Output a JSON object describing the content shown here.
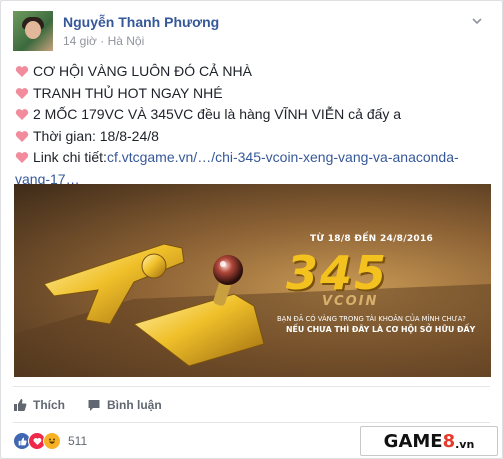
{
  "post": {
    "author": "Nguyễn Thanh Phương",
    "time": "14 giờ",
    "separator": "·",
    "location": "Hà Nội",
    "lines": [
      "CƠ HỘI VÀNG LUÔN ĐÓ CẢ NHÀ",
      "TRANH THỦ HOT NGAY NHÉ",
      "2 MỐC 179VC VÀ 345VC đều là hàng VĨNH VIỄN cả đấy a",
      "Thời gian: 18/8-24/8"
    ],
    "link_prefix": "Link chi tiết:",
    "link_text_1": "cf.vtcgame.vn/…/chi-345-vcoin-xeng-vang-va-anaconda-",
    "link_text_2": "vang-17…"
  },
  "banner": {
    "date": "TỪ 18/8 ĐẾN 24/8/2016",
    "big_number": "345",
    "unit": "VCOIN",
    "question": "BẠN ĐÃ CÓ VÀNG TRONG TÀI KHOẢN CỦA MÌNH CHƯA?",
    "answer": "NẾU CHƯA THÌ ĐÂY LÀ CƠ HỘI SỞ HỮU ĐẤY"
  },
  "actions": {
    "like": "Thích",
    "comment": "Bình luận"
  },
  "reactions": {
    "count": "511",
    "icons": [
      "like-icon",
      "love-icon",
      "haha-icon"
    ]
  },
  "watermark": {
    "part1": "GAME",
    "part2": "8",
    "part3": ".vn"
  },
  "colors": {
    "author": "#365899",
    "heart": "#f28b9b",
    "accent_gold": "#f4c21f"
  }
}
